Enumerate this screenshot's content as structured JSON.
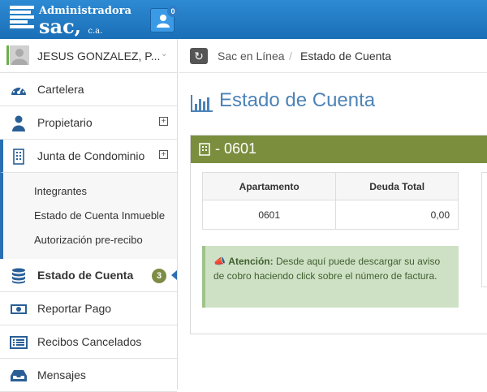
{
  "app": {
    "logo_top": "Administradora",
    "logo_main": "sac,",
    "logo_suffix": "c.a.",
    "notif_count": "0"
  },
  "user": {
    "name": "JESUS GONZALEZ, P..."
  },
  "sidebar": {
    "items": [
      {
        "label": "Cartelera",
        "icon": "dashboard-icon"
      },
      {
        "label": "Propietario",
        "icon": "user-icon"
      },
      {
        "label": "Junta de Condominio",
        "icon": "building-icon"
      },
      {
        "label": "Estado de Cuenta",
        "icon": "database-icon",
        "badge": "3"
      },
      {
        "label": "Reportar Pago",
        "icon": "money-icon"
      },
      {
        "label": "Recibos Cancelados",
        "icon": "list-icon"
      },
      {
        "label": "Mensajes",
        "icon": "inbox-icon"
      }
    ],
    "sub_items": [
      "Integrantes",
      "Estado de Cuenta Inmueble",
      "Autorización pre-recibo"
    ]
  },
  "breadcrumb": {
    "root": "Sac en Línea",
    "sep": "/",
    "current": "Estado de Cuenta"
  },
  "page": {
    "title": "Estado de Cuenta"
  },
  "panel": {
    "title": "- 0601",
    "table": {
      "headers": [
        "Apartamento",
        "Deuda Total"
      ],
      "rows": [
        [
          "0601",
          "0,00"
        ]
      ]
    },
    "alert": {
      "label": "Atención:",
      "text": "Desde aquí puede descargar su aviso de cobro haciendo click sobre el número de factura."
    }
  },
  "colors": {
    "topbar": "#1a6fb7",
    "panel_header": "#7a8e3e",
    "title": "#4d83b8",
    "badge": "#7d8c45"
  }
}
